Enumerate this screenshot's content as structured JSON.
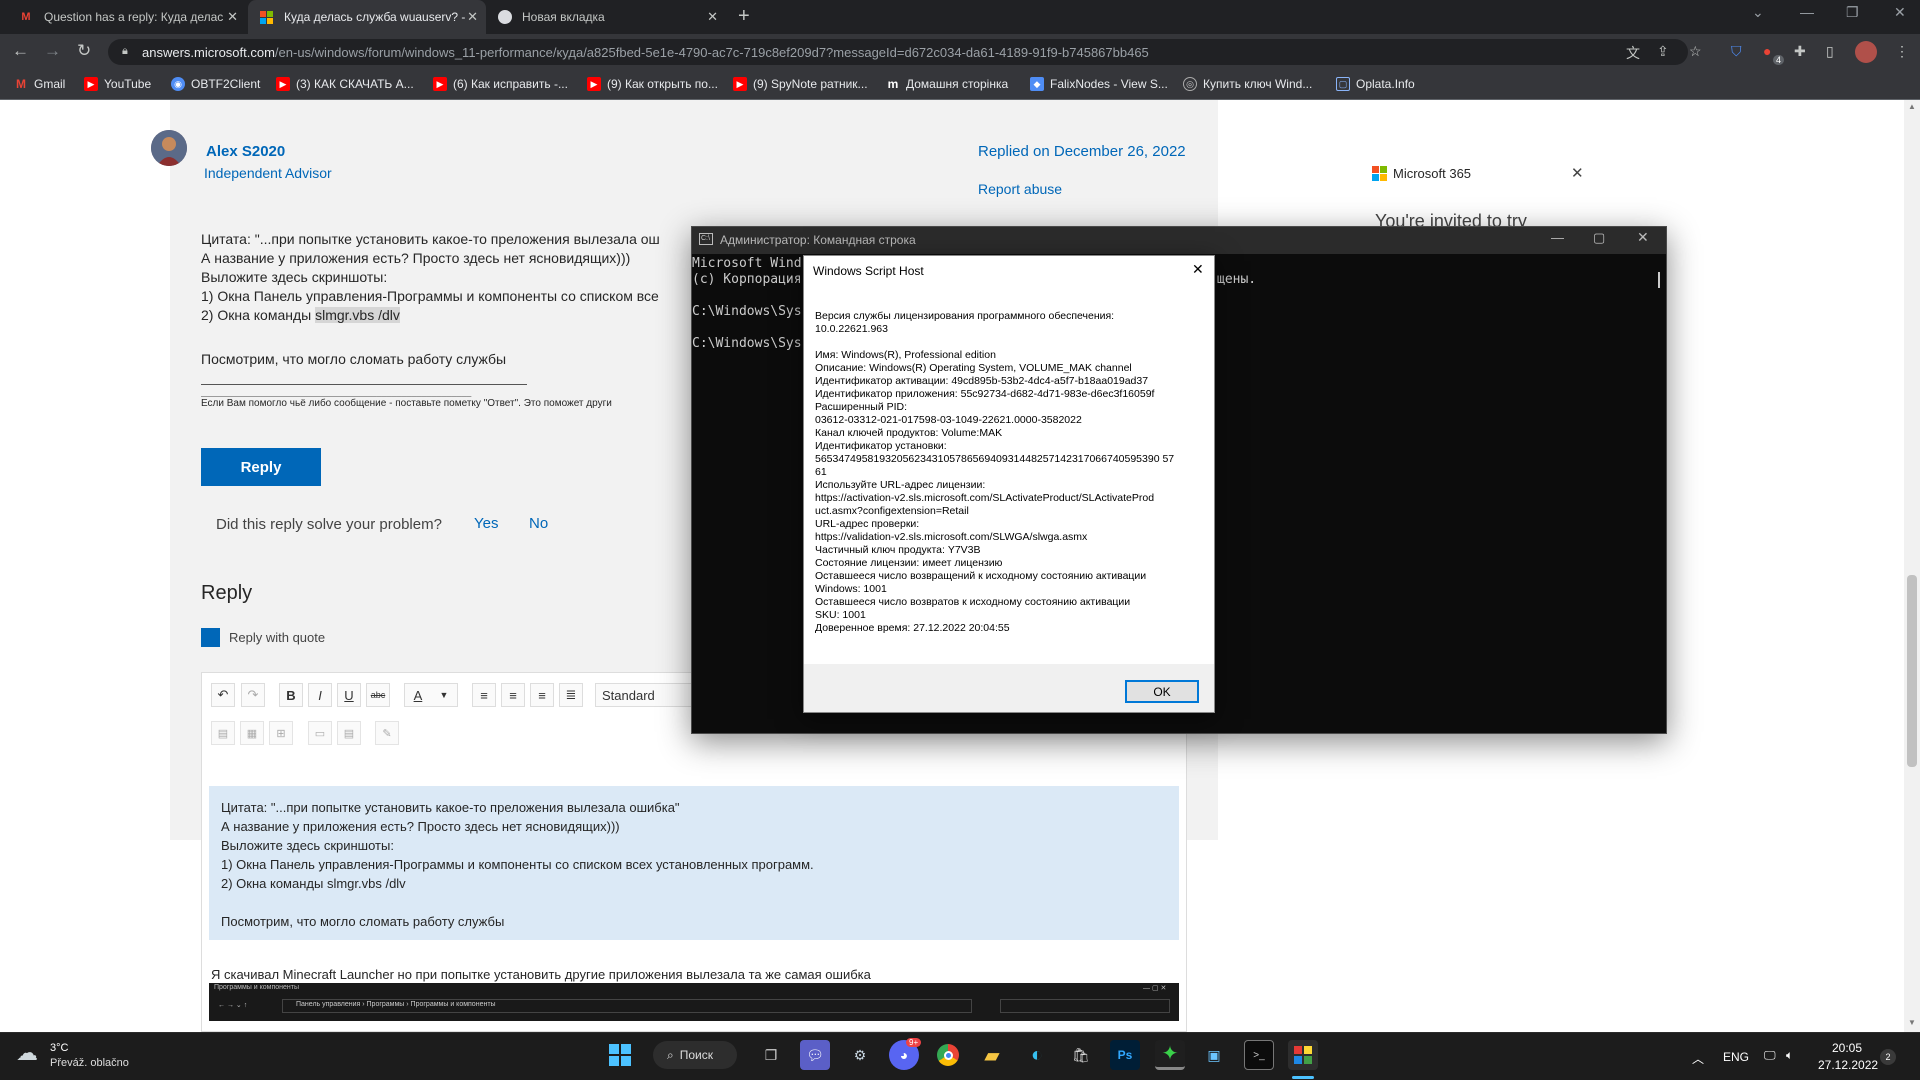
{
  "browser": {
    "tabs": [
      {
        "title": "Question has a reply: Куда делас",
        "active": false
      },
      {
        "title": "Куда делась служба wuauserv? -",
        "active": true
      },
      {
        "title": "Новая вкладка",
        "active": false
      }
    ],
    "url_host": "answers.microsoft.com",
    "url_path": "/en-us/windows/forum/windows_11-performance/куда/a825fbed-5e1e-4790-ac7c-719c8ef209d7?messageId=d672c034-da61-4189-91f9-b745867bb465",
    "extension_badge": "4",
    "bookmarks": [
      {
        "label": "Gmail",
        "icon": "gmail-icon",
        "color": "#ea4335"
      },
      {
        "label": "YouTube",
        "icon": "youtube-icon",
        "color": "#ff0000"
      },
      {
        "label": "OBTF2Client",
        "icon": "obtf2-icon",
        "color": "#4f8df5"
      },
      {
        "label": "(3) КАК СКАЧАТЬ А...",
        "icon": "youtube-icon",
        "color": "#ff0000"
      },
      {
        "label": "(6) Как исправить -...",
        "icon": "youtube-icon",
        "color": "#ff0000"
      },
      {
        "label": "(9) Как открыть по...",
        "icon": "youtube-icon",
        "color": "#ff0000"
      },
      {
        "label": "(9) SpyNote ратник...",
        "icon": "youtube-icon",
        "color": "#ff0000"
      },
      {
        "label": "Домашня сторінка",
        "icon": "m-icon",
        "color": "#ffffff"
      },
      {
        "label": "FalixNodes - View S...",
        "icon": "falix-icon",
        "color": "#4f8df5"
      },
      {
        "label": "Купить ключ Wind...",
        "icon": "key-site-icon",
        "color": "#888888"
      },
      {
        "label": "Oplata.Info",
        "icon": "page-icon",
        "color": "#8ab4f8"
      }
    ]
  },
  "post": {
    "author": "Alex S2020",
    "role": "Independent Advisor",
    "replied_on": "Replied on December 26, 2022",
    "report_abuse": "Report abuse",
    "body": [
      "Цитата: \"...при попытке установить какое-то преложения вылезала ош",
      "А название у приложения есть? Просто здесь нет ясновидящих)))",
      "Выложите здесь скриншоты:",
      "1) Окна Панель управления-Программы и компоненты со списком все",
      "2) Окна команды "
    ],
    "command_highlight": "slmgr.vbs /dlv",
    "closing": "Посмотрим, что могло сломать работу службы",
    "signature_line": "______________________________________________________",
    "signature": "Если Вам помогло чьё либо сообщение - поставьте пометку \"Ответ\". Это поможет други",
    "reply_button": "Reply",
    "solve_question": "Did this reply solve your problem?",
    "yes": "Yes",
    "no": "No"
  },
  "reply_section": {
    "heading": "Reply",
    "reply_with_quote": "Reply with quote",
    "format_select": "Standard",
    "quote_lines": [
      "Цитата: \"...при попытке установить какое-то преложения вылезала ошибка\"",
      "А название у приложения есть? Просто здесь нет ясновидящих)))",
      "Выложите здесь скриншоты:",
      "1) Окна Панель управления-Программы и компоненты со списком всех установленных программ.",
      "2) Окна команды slmgr.vbs /dlv",
      "",
      "Посмотрим, что могло сломать работу службы"
    ],
    "user_text": "Я скачивал Minecraft Launcher но при попытке установить другие приложения вылезала та же самая ошибка",
    "embedded_screenshot_title": "Программы и компоненты",
    "embedded_screenshot_path": "Панель управления  ›  Программы  ›  Программы и компоненты"
  },
  "ms365": {
    "label": "Microsoft 365",
    "teaser": "You're invited to try"
  },
  "cmd": {
    "title": "Администратор: Командная строка",
    "lines": [
      "Microsoft Wind",
      "(c) Корпорация",
      "",
      "C:\\Windows\\Sys",
      "",
      "C:\\Windows\\Sys"
    ],
    "right_fragment": "щены."
  },
  "dialog": {
    "title": "Windows Script Host",
    "lines": [
      "Версия службы лицензирования программного обеспечения:",
      "10.0.22621.963",
      "",
      "Имя: Windows(R), Professional edition",
      "Описание: Windows(R) Operating System, VOLUME_MAK channel",
      "Идентификатор активации: 49cd895b-53b2-4dc4-a5f7-b18aa019ad37",
      "Идентификатор приложения: 55c92734-d682-4d71-983e-d6ec3f16059f",
      "Расширенный PID:",
      "03612-03312-021-017598-03-1049-22621.0000-3582022",
      "Канал ключей продуктов: Volume:MAK",
      "Идентификатор установки:",
      "56534749581932056234310578656940931448257142317066740595390 57",
      "61",
      "Используйте URL-адрес лицензии:",
      "https://activation-v2.sls.microsoft.com/SLActivateProduct/SLActivateProd",
      "uct.asmx?configextension=Retail",
      "URL-адрес проверки:",
      "https://validation-v2.sls.microsoft.com/SLWGA/slwga.asmx",
      "Частичный ключ продукта: Y7V3B",
      "Состояние лицензии: имеет лицензию",
      "Оставшееся число возвращений к исходному состоянию активации",
      "Windows: 1001",
      "Оставшееся число возвратов к исходному состоянию активации",
      "SKU: 1001",
      "Доверенное время: 27.12.2022 20:04:55"
    ],
    "ok": "OK"
  },
  "taskbar": {
    "weather_temp": "3°C",
    "weather_desc": "Převáž. oblačno",
    "search_label": "Поиск",
    "discord_badge": "9+",
    "lang": "ENG",
    "time": "20:05",
    "date": "27.12.2022",
    "notif_count": "2"
  }
}
